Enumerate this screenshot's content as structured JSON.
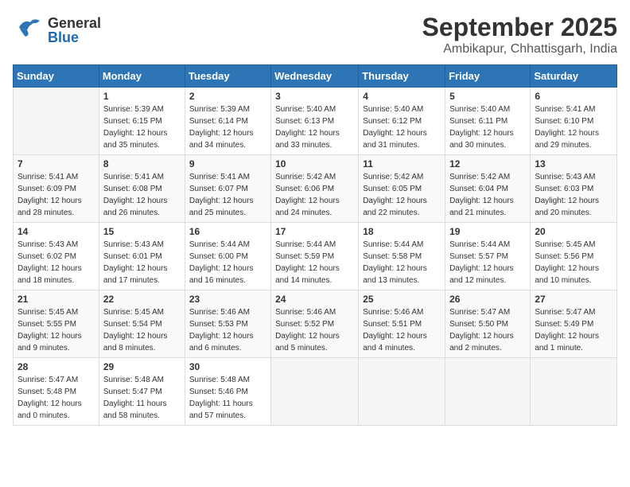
{
  "header": {
    "logo": {
      "general": "General",
      "blue": "Blue"
    },
    "month": "September 2025",
    "location": "Ambikapur, Chhattisgarh, India"
  },
  "weekdays": [
    "Sunday",
    "Monday",
    "Tuesday",
    "Wednesday",
    "Thursday",
    "Friday",
    "Saturday"
  ],
  "weeks": [
    [
      {
        "day": "",
        "sunrise": "",
        "sunset": "",
        "daylight": ""
      },
      {
        "day": "1",
        "sunrise": "Sunrise: 5:39 AM",
        "sunset": "Sunset: 6:15 PM",
        "daylight": "Daylight: 12 hours and 35 minutes."
      },
      {
        "day": "2",
        "sunrise": "Sunrise: 5:39 AM",
        "sunset": "Sunset: 6:14 PM",
        "daylight": "Daylight: 12 hours and 34 minutes."
      },
      {
        "day": "3",
        "sunrise": "Sunrise: 5:40 AM",
        "sunset": "Sunset: 6:13 PM",
        "daylight": "Daylight: 12 hours and 33 minutes."
      },
      {
        "day": "4",
        "sunrise": "Sunrise: 5:40 AM",
        "sunset": "Sunset: 6:12 PM",
        "daylight": "Daylight: 12 hours and 31 minutes."
      },
      {
        "day": "5",
        "sunrise": "Sunrise: 5:40 AM",
        "sunset": "Sunset: 6:11 PM",
        "daylight": "Daylight: 12 hours and 30 minutes."
      },
      {
        "day": "6",
        "sunrise": "Sunrise: 5:41 AM",
        "sunset": "Sunset: 6:10 PM",
        "daylight": "Daylight: 12 hours and 29 minutes."
      }
    ],
    [
      {
        "day": "7",
        "sunrise": "Sunrise: 5:41 AM",
        "sunset": "Sunset: 6:09 PM",
        "daylight": "Daylight: 12 hours and 28 minutes."
      },
      {
        "day": "8",
        "sunrise": "Sunrise: 5:41 AM",
        "sunset": "Sunset: 6:08 PM",
        "daylight": "Daylight: 12 hours and 26 minutes."
      },
      {
        "day": "9",
        "sunrise": "Sunrise: 5:41 AM",
        "sunset": "Sunset: 6:07 PM",
        "daylight": "Daylight: 12 hours and 25 minutes."
      },
      {
        "day": "10",
        "sunrise": "Sunrise: 5:42 AM",
        "sunset": "Sunset: 6:06 PM",
        "daylight": "Daylight: 12 hours and 24 minutes."
      },
      {
        "day": "11",
        "sunrise": "Sunrise: 5:42 AM",
        "sunset": "Sunset: 6:05 PM",
        "daylight": "Daylight: 12 hours and 22 minutes."
      },
      {
        "day": "12",
        "sunrise": "Sunrise: 5:42 AM",
        "sunset": "Sunset: 6:04 PM",
        "daylight": "Daylight: 12 hours and 21 minutes."
      },
      {
        "day": "13",
        "sunrise": "Sunrise: 5:43 AM",
        "sunset": "Sunset: 6:03 PM",
        "daylight": "Daylight: 12 hours and 20 minutes."
      }
    ],
    [
      {
        "day": "14",
        "sunrise": "Sunrise: 5:43 AM",
        "sunset": "Sunset: 6:02 PM",
        "daylight": "Daylight: 12 hours and 18 minutes."
      },
      {
        "day": "15",
        "sunrise": "Sunrise: 5:43 AM",
        "sunset": "Sunset: 6:01 PM",
        "daylight": "Daylight: 12 hours and 17 minutes."
      },
      {
        "day": "16",
        "sunrise": "Sunrise: 5:44 AM",
        "sunset": "Sunset: 6:00 PM",
        "daylight": "Daylight: 12 hours and 16 minutes."
      },
      {
        "day": "17",
        "sunrise": "Sunrise: 5:44 AM",
        "sunset": "Sunset: 5:59 PM",
        "daylight": "Daylight: 12 hours and 14 minutes."
      },
      {
        "day": "18",
        "sunrise": "Sunrise: 5:44 AM",
        "sunset": "Sunset: 5:58 PM",
        "daylight": "Daylight: 12 hours and 13 minutes."
      },
      {
        "day": "19",
        "sunrise": "Sunrise: 5:44 AM",
        "sunset": "Sunset: 5:57 PM",
        "daylight": "Daylight: 12 hours and 12 minutes."
      },
      {
        "day": "20",
        "sunrise": "Sunrise: 5:45 AM",
        "sunset": "Sunset: 5:56 PM",
        "daylight": "Daylight: 12 hours and 10 minutes."
      }
    ],
    [
      {
        "day": "21",
        "sunrise": "Sunrise: 5:45 AM",
        "sunset": "Sunset: 5:55 PM",
        "daylight": "Daylight: 12 hours and 9 minutes."
      },
      {
        "day": "22",
        "sunrise": "Sunrise: 5:45 AM",
        "sunset": "Sunset: 5:54 PM",
        "daylight": "Daylight: 12 hours and 8 minutes."
      },
      {
        "day": "23",
        "sunrise": "Sunrise: 5:46 AM",
        "sunset": "Sunset: 5:53 PM",
        "daylight": "Daylight: 12 hours and 6 minutes."
      },
      {
        "day": "24",
        "sunrise": "Sunrise: 5:46 AM",
        "sunset": "Sunset: 5:52 PM",
        "daylight": "Daylight: 12 hours and 5 minutes."
      },
      {
        "day": "25",
        "sunrise": "Sunrise: 5:46 AM",
        "sunset": "Sunset: 5:51 PM",
        "daylight": "Daylight: 12 hours and 4 minutes."
      },
      {
        "day": "26",
        "sunrise": "Sunrise: 5:47 AM",
        "sunset": "Sunset: 5:50 PM",
        "daylight": "Daylight: 12 hours and 2 minutes."
      },
      {
        "day": "27",
        "sunrise": "Sunrise: 5:47 AM",
        "sunset": "Sunset: 5:49 PM",
        "daylight": "Daylight: 12 hours and 1 minute."
      }
    ],
    [
      {
        "day": "28",
        "sunrise": "Sunrise: 5:47 AM",
        "sunset": "Sunset: 5:48 PM",
        "daylight": "Daylight: 12 hours and 0 minutes."
      },
      {
        "day": "29",
        "sunrise": "Sunrise: 5:48 AM",
        "sunset": "Sunset: 5:47 PM",
        "daylight": "Daylight: 11 hours and 58 minutes."
      },
      {
        "day": "30",
        "sunrise": "Sunrise: 5:48 AM",
        "sunset": "Sunset: 5:46 PM",
        "daylight": "Daylight: 11 hours and 57 minutes."
      },
      {
        "day": "",
        "sunrise": "",
        "sunset": "",
        "daylight": ""
      },
      {
        "day": "",
        "sunrise": "",
        "sunset": "",
        "daylight": ""
      },
      {
        "day": "",
        "sunrise": "",
        "sunset": "",
        "daylight": ""
      },
      {
        "day": "",
        "sunrise": "",
        "sunset": "",
        "daylight": ""
      }
    ]
  ]
}
